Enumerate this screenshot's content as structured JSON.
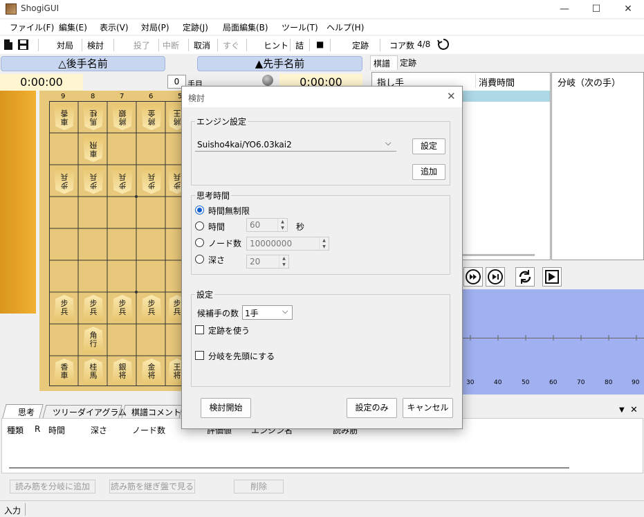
{
  "window": {
    "title": "ShogiGUI",
    "minimize": "—",
    "maximize": "☐",
    "close": "✕"
  },
  "menu": [
    "ファイル(F)",
    "編集(E)",
    "表示(V)",
    "対局(P)",
    "定跡(J)",
    "局面編集(B)",
    "ツール(T)",
    "ヘルプ(H)"
  ],
  "toolbar": {
    "taikyoku": "対局",
    "kento": "検討",
    "toryo": "投了",
    "chudan": "中断",
    "torikeshi": "取消",
    "sugu": "すぐ",
    "hint": "ヒント",
    "tsume": "詰",
    "stop": "■",
    "joseki": "定跡",
    "core_label": "コア数",
    "core_value": "4/8"
  },
  "players": {
    "gote": "△後手名前",
    "sente": "▲先手名前",
    "gote_time": "0:00:00",
    "sente_time": "0:00:00",
    "move_count": "0",
    "move_unit": "手目"
  },
  "board": {
    "files": [
      "9",
      "8",
      "7",
      "6",
      "5"
    ],
    "gote_back": [
      {
        "top": "車",
        "bot": "香"
      },
      {
        "top": "馬",
        "bot": "桂"
      },
      {
        "top": "將",
        "bot": "銀"
      },
      {
        "top": "將",
        "bot": "金"
      },
      {
        "top": "將",
        "bot": "王"
      }
    ],
    "gote_rook": {
      "top": "車",
      "bot": "飛"
    },
    "pawn": {
      "top": "步",
      "bot": "兵"
    },
    "sente_bishop": {
      "top": "角",
      "bot": "行"
    },
    "sente_back": [
      {
        "top": "香",
        "bot": "車"
      },
      {
        "top": "桂",
        "bot": "馬"
      },
      {
        "top": "銀",
        "bot": "将"
      },
      {
        "top": "金",
        "bot": "将"
      },
      {
        "top": "王",
        "bot": "将"
      }
    ]
  },
  "right": {
    "tab_kifu": "棋譜",
    "tab_joseki": "定跡",
    "col_move": "指し手",
    "col_time": "消費時間",
    "col_branch": "分岐（次の手）"
  },
  "graph": {
    "ticks": [
      "30",
      "40",
      "50",
      "60",
      "70",
      "80",
      "90"
    ]
  },
  "bottom": {
    "tabs": [
      "思考",
      "ツリーダイアグラム",
      "棋譜コメント"
    ],
    "cols": [
      "種類",
      "R",
      "時間",
      "深さ",
      "ノード数",
      "評価値",
      "エンジン名",
      "読み筋"
    ],
    "add_branch": "読み筋を分岐に追加",
    "view_board": "読み筋を継ぎ盤で見る",
    "delete": "削除",
    "input_label": "入力"
  },
  "dialog": {
    "title": "検討",
    "engine_group": "エンジン設定",
    "engine_value": "Suisho4kai/YO6.03kai2",
    "settings_btn": "設定",
    "add_btn": "追加",
    "time_group": "思考時間",
    "opt_unlimited": "時間無制限",
    "opt_time": "時間",
    "time_value": "60",
    "time_unit": "秒",
    "opt_nodes": "ノード数",
    "nodes_value": "10000000",
    "opt_depth": "深さ",
    "depth_value": "20",
    "settings_group": "設定",
    "candidates_label": "候補手の数",
    "candidates_value": "1手",
    "use_joseki": "定跡を使う",
    "branch_first": "分岐を先頭にする",
    "start_btn": "検討開始",
    "settings_only_btn": "設定のみ",
    "cancel_btn": "キャンセル"
  }
}
